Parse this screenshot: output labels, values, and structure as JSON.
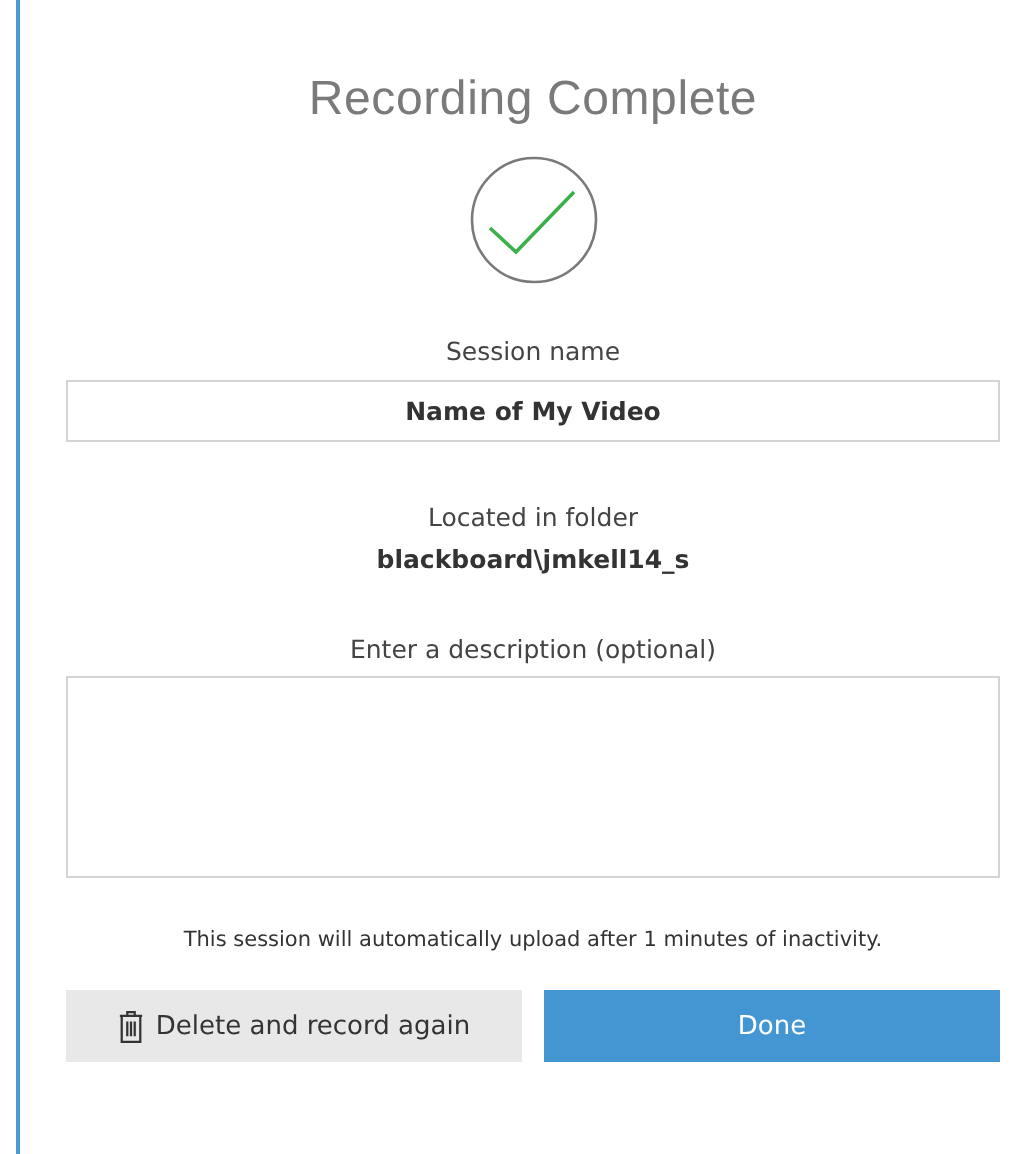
{
  "dialog": {
    "title": "Recording Complete",
    "session_name": {
      "label": "Session name",
      "value": "Name of My Video"
    },
    "folder": {
      "label": "Located in folder",
      "path": "blackboard\\jmkell14_s"
    },
    "description": {
      "label": "Enter a description (optional)"
    },
    "notice": "This session will automatically upload after 1 minutes of inactivity.",
    "buttons": [
      {
        "kind": "secondary",
        "label": "Delete and record again"
      },
      {
        "kind": "primary",
        "label": "Done"
      }
    ]
  }
}
